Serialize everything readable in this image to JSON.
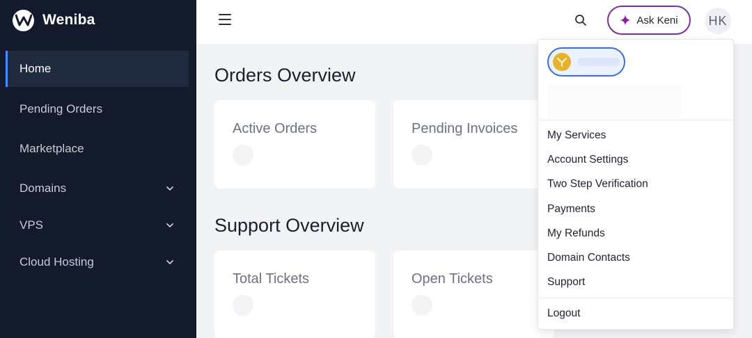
{
  "brand": {
    "name": "Weniba",
    "logo_icon": "w-logo-icon"
  },
  "sidebar": {
    "items": [
      {
        "label": "Home",
        "active": true,
        "expandable": false
      },
      {
        "label": "Pending Orders",
        "active": false,
        "expandable": false
      },
      {
        "label": "Marketplace",
        "active": false,
        "expandable": false
      },
      {
        "label": "Domains",
        "active": false,
        "expandable": true
      },
      {
        "label": "VPS",
        "active": false,
        "expandable": true
      },
      {
        "label": "Cloud Hosting",
        "active": false,
        "expandable": true
      }
    ]
  },
  "header": {
    "menu_icon": "hamburger-icon",
    "search_icon": "search-icon",
    "ask_label": "Ask Keni",
    "ask_icon": "sparkle-icon",
    "avatar_initials": "HK"
  },
  "main": {
    "orders_title": "Orders Overview",
    "orders_cards": [
      "Active Orders",
      "Pending Invoices"
    ],
    "support_title": "Support Overview",
    "support_cards": [
      "Total Tickets",
      "Open Tickets"
    ]
  },
  "user_menu": {
    "items": [
      "My Services",
      "Account Settings",
      "Two Step Verification",
      "Payments",
      "My Refunds",
      "Domain Contacts",
      "Support"
    ],
    "logout": "Logout"
  },
  "colors": {
    "sidebar_bg": "#121a2b",
    "accent": "#4a8dff",
    "ask_border": "#7b2d9c",
    "coin": "#e6b22c"
  }
}
